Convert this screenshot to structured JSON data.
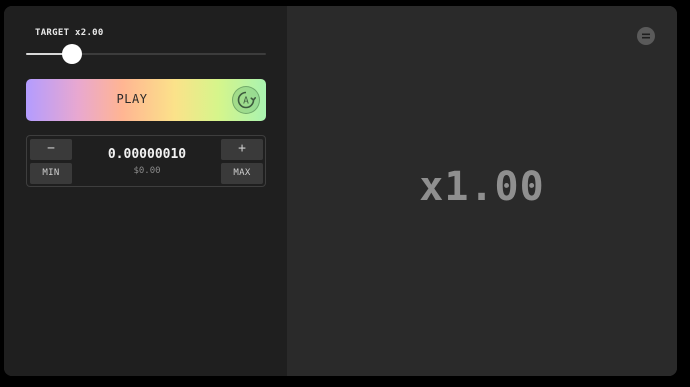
{
  "target": {
    "label": "TARGET x2.00",
    "slider_fraction": 0.19
  },
  "play": {
    "label": "PLAY",
    "autoplay_icon": "autoplay-icon",
    "autoplay_letter": "A"
  },
  "bet": {
    "decrement_label": "−",
    "increment_label": "+",
    "min_label": "MIN",
    "max_label": "MAX",
    "amount": "0.00000010",
    "usd": "$0.00"
  },
  "game": {
    "multiplier": "x1.00",
    "menu_icon": "menu-icon"
  },
  "colors": {
    "background": "#000000",
    "left_panel": "#1f1f1f",
    "right_panel": "#2a2a2a",
    "multiplier_text": "#8f8f8f"
  }
}
